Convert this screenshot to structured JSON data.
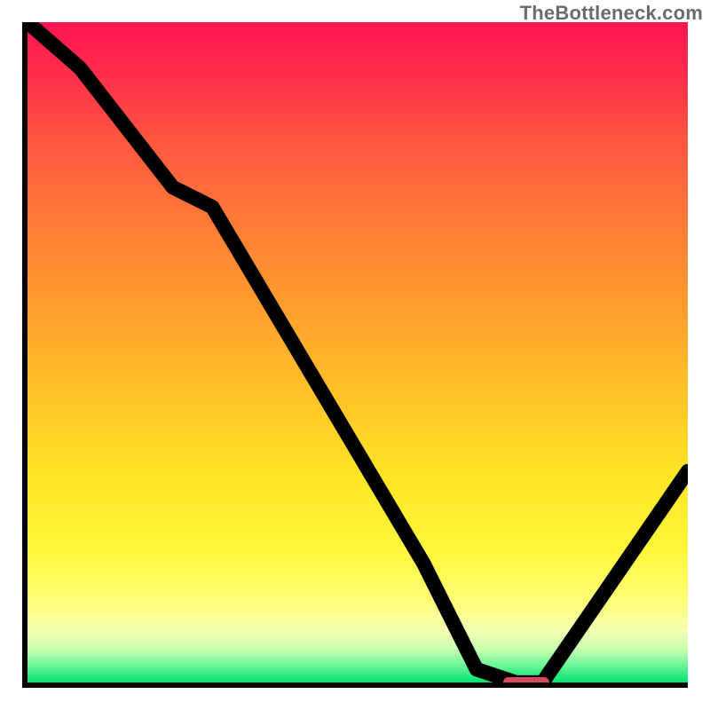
{
  "watermark": "TheBottleneck.com",
  "chart_data": {
    "type": "line",
    "title": "",
    "xlabel": "",
    "ylabel": "",
    "xlim": [
      0,
      100
    ],
    "ylim": [
      0,
      100
    ],
    "x": [
      0,
      8,
      22,
      28,
      60,
      68,
      74,
      78,
      100
    ],
    "values": [
      100,
      93,
      75,
      72,
      18,
      2,
      0,
      0,
      32
    ],
    "optimum_range": {
      "start": 72,
      "end": 79,
      "y": 0
    },
    "background": "rainbow-vertical-gradient",
    "note": "Y is a qualitative bottleneck score (100 = worst / red at top, 0 = best / green at bottom). Values estimated from pixel positions; no axis ticks or labels are rendered in the image."
  },
  "colors": {
    "axis": "#000000",
    "curve": "#000000",
    "marker": "#d9495d",
    "gradient_top": "#ff1452",
    "gradient_bottom": "#00e472",
    "watermark": "#6b6b6b"
  }
}
